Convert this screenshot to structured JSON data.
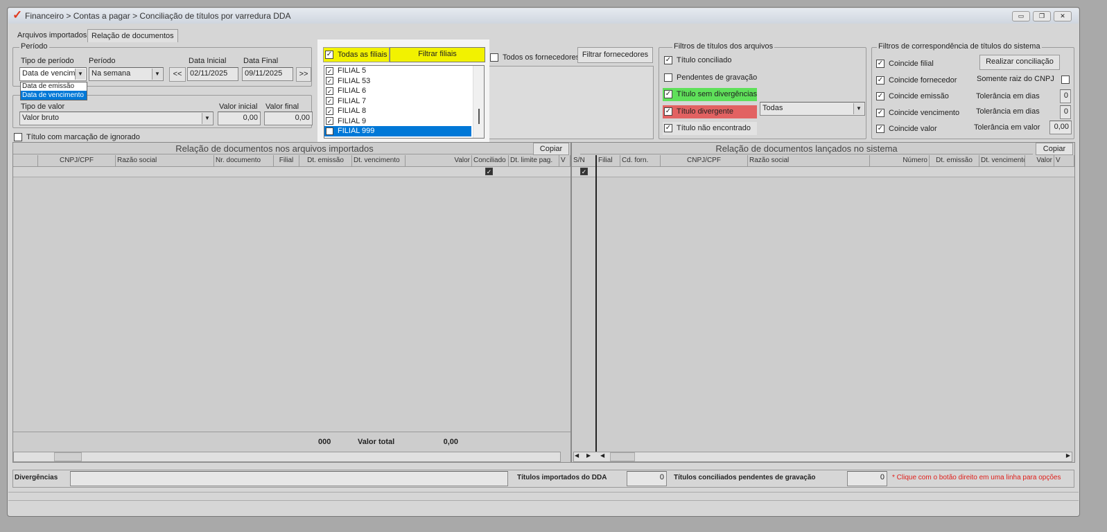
{
  "window": {
    "title": "Financeiro > Contas a pagar > Conciliação de títulos por varredura DDA"
  },
  "tabs": [
    {
      "label": "Arquivos importados"
    },
    {
      "label": "Relação de documentos"
    }
  ],
  "periodo": {
    "legend": "Período",
    "tipo_label": "Tipo de período",
    "tipo_value": "Data de vencim",
    "periodo_label": "Período",
    "periodo_value": "Na semana",
    "prev": "<<",
    "next": ">>",
    "data_inicial_label": "Data Inicial",
    "data_inicial": "02/11/2025",
    "data_final_label": "Data Final",
    "data_final": "09/11/2025",
    "dropdown_options": [
      "Data de emissão",
      "Data de vencimento"
    ]
  },
  "valor": {
    "tipo_label": "Tipo de valor",
    "tipo_value": "Valor bruto",
    "inicial_label": "Valor inicial",
    "inicial": "0,00",
    "final_label": "Valor final",
    "final": "0,00"
  },
  "ignorado_label": "Título com marcação de ignorado",
  "filiais": {
    "todas_label": "Todas as filiais",
    "filtrar_label": "Filtrar filiais",
    "items": [
      "FILIAL 5",
      "FILIAL 53",
      "FILIAL 6",
      "FILIAL 7",
      "FILIAL 8",
      "FILIAL 9",
      "FILIAL 999"
    ]
  },
  "fornecedores": {
    "todos_label": "Todos os fornecedores",
    "filtrar_label": "Filtrar fornecedores"
  },
  "filtros_arquivos": {
    "legend": "Filtros de títulos dos arquivos",
    "items": [
      {
        "label": "Título conciliado",
        "checked": true
      },
      {
        "label": "Pendentes de gravação",
        "checked": false
      },
      {
        "label": "Título sem divergências",
        "checked": true,
        "color": "#5fe05a"
      },
      {
        "label": "Título divergente",
        "checked": true,
        "color": "#e26262"
      },
      {
        "label": "Título não encontrado",
        "checked": true
      }
    ],
    "divergente_combo": "Todas"
  },
  "filtros_sistema": {
    "legend": "Filtros de correspondência de títulos do sistema",
    "items": [
      "Coincide filial",
      "Coincide fornecedor",
      "Coincide emissão",
      "Coincide vencimento",
      "Coincide valor"
    ],
    "realizar_label": "Realizar conciliação",
    "somente_raiz_label": "Somente raiz do CNPJ",
    "tol_dias_label": "Tolerância em dias",
    "tol_dias_1": "0",
    "tol_dias_2": "0",
    "tol_valor_label": "Tolerância em valor",
    "tol_valor": "0,00"
  },
  "left_grid": {
    "title": "Relação de documentos nos arquivos importados",
    "copy": "Copiar",
    "columns": [
      "",
      "CNPJ/CPF",
      "Razão social",
      "Nr. documento",
      "Filial",
      "Dt. emissão",
      "Dt. vencimento",
      "Valor",
      "Conciliado",
      "Dt. limite pag.",
      "V"
    ],
    "footer": {
      "count": "000",
      "total_label": "Valor total",
      "total": "0,00"
    }
  },
  "right_grid": {
    "title": "Relação de documentos lançados no sistema",
    "copy": "Copiar",
    "columns": [
      "S/N",
      "Filial",
      "Cd. forn.",
      "CNPJ/CPF",
      "Razão social",
      "Número",
      "Dt. emissão",
      "Dt. vencimento",
      "Valor",
      "V"
    ]
  },
  "bottom": {
    "divergencias_label": "Divergências",
    "importados_label": "Títulos importados do DDA",
    "importados": "0",
    "pendentes_label": "Títulos conciliados pendentes de gravação",
    "pendentes": "0",
    "hint": "* Clique com o botão direito em uma linha para opções"
  },
  "colors": {
    "highlight": "#0078d7",
    "yellow": "#f2f200",
    "hint": "#e0201c"
  }
}
